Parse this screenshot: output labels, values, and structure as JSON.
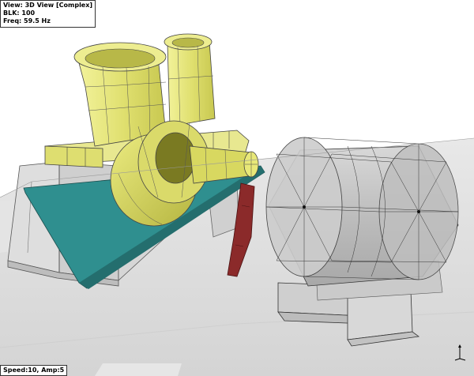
{
  "info": {
    "view": "View: 3D View [Complex]",
    "blk": "BLK: 100",
    "freq": "Freq: 59.5 Hz"
  },
  "status": {
    "text": "Speed:10, Amp:5"
  },
  "icons": {
    "axis_triad": "xyz-axis-triad-icon"
  },
  "colors": {
    "pump_body": "#e6e67a",
    "pump_dark": "#8e8e2a",
    "motor_fill": "#c4c4c4",
    "shaft_teal": "#2f8f8f",
    "coupling_red": "#8b2a2a",
    "floor": "#dcdcdc"
  }
}
